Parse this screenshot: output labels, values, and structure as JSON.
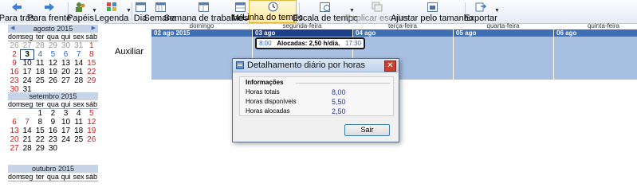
{
  "toolbar": {
    "back": "Para trás",
    "forward": "Para frente",
    "papers": "Papéis",
    "legend": "Legenda",
    "day": "Dia",
    "week": "Semana",
    "work_week": "Semana de trabalho",
    "month": "Mês",
    "timeline": "Linha do tempo",
    "time_scale": "Escala de tempo",
    "replicate_scales": "Replicar escalas",
    "fit_size": "Ajustar pelo tamanho",
    "export": "Exportar"
  },
  "calendar": {
    "months": [
      {
        "title": "agosto 2015",
        "weekdays": [
          "dom",
          "seg",
          "ter",
          "qua",
          "qui",
          "sex",
          "sáb"
        ],
        "weeks": [
          [
            "26",
            "27",
            "28",
            "29",
            "30",
            "31",
            "1"
          ],
          [
            "2",
            "3",
            "4",
            "5",
            "6",
            "7",
            "8"
          ],
          [
            "9",
            "10",
            "11",
            "12",
            "13",
            "14",
            "15"
          ],
          [
            "16",
            "17",
            "18",
            "19",
            "20",
            "21",
            "22"
          ],
          [
            "23",
            "24",
            "25",
            "26",
            "27",
            "28",
            "29"
          ],
          [
            "30",
            "31",
            "",
            "",
            "",
            "",
            ""
          ]
        ]
      },
      {
        "title": "setembro 2015",
        "weekdays": [
          "dom",
          "seg",
          "ter",
          "qua",
          "qui",
          "sex",
          "sáb"
        ],
        "weeks": [
          [
            "",
            "",
            "1",
            "2",
            "3",
            "4",
            "5"
          ],
          [
            "6",
            "7",
            "8",
            "9",
            "10",
            "11",
            "12"
          ],
          [
            "13",
            "14",
            "15",
            "16",
            "17",
            "18",
            "19"
          ],
          [
            "20",
            "21",
            "22",
            "23",
            "24",
            "25",
            "26"
          ],
          [
            "27",
            "28",
            "29",
            "30",
            "",
            "",
            ""
          ]
        ]
      },
      {
        "title": "outubro 2015",
        "weekdays": [
          "dom",
          "seg",
          "ter",
          "qua",
          "qui",
          "sex",
          "sáb"
        ],
        "weeks": []
      }
    ]
  },
  "schedule": {
    "resource": "Auxiliar",
    "days": [
      {
        "weekday": "domingo",
        "date": "02 ago 2015"
      },
      {
        "weekday": "segunda-feira",
        "date": "03 ago"
      },
      {
        "weekday": "terça-feira",
        "date": "04 ago"
      },
      {
        "weekday": "quarta-feira",
        "date": "05 ago"
      },
      {
        "weekday": "quinta-feira",
        "date": "06 ago"
      }
    ],
    "appointment": {
      "start": "8:00",
      "text": "Alocadas: 2,50 h/dia.",
      "end": "17:30"
    }
  },
  "dialog": {
    "title": "Detalhamento diário por horas",
    "group_title": "Informações",
    "rows": [
      {
        "label": "Horas totais",
        "value": "8,00"
      },
      {
        "label": "Horas disponíveis",
        "value": "5,50"
      },
      {
        "label": "Horas alocadas",
        "value": "2,50"
      }
    ],
    "exit_button": "Sair"
  },
  "colors": {
    "accent": "#3f6fb4",
    "selected": "#1b3f88",
    "cell": "#a7c0e2",
    "close": "#c74130"
  }
}
